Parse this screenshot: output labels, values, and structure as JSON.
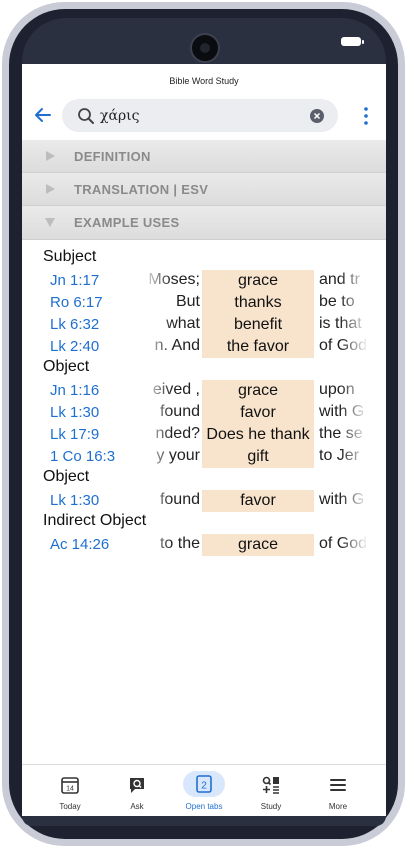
{
  "app": {
    "title": "Bible Word Study"
  },
  "search": {
    "query": "χάρις"
  },
  "sections": [
    {
      "label": "DEFINITION",
      "expanded": false
    },
    {
      "label": "TRANSLATION | ESV",
      "expanded": false
    },
    {
      "label": "EXAMPLE USES",
      "expanded": true
    }
  ],
  "groups": [
    {
      "label": "Subject",
      "rows": [
        {
          "ref": "Jn 1:17",
          "left": "Moses;",
          "word": "grace",
          "right": "and tr"
        },
        {
          "ref": "Ro 6:17",
          "left": "But",
          "word": "thanks",
          "right": "be to"
        },
        {
          "ref": "Lk 6:32",
          "left": "what",
          "word": "benefit",
          "right": "is that"
        },
        {
          "ref": "Lk 2:40",
          "left": "n. And",
          "word": "the favor",
          "right": "of God"
        }
      ]
    },
    {
      "label": "Object",
      "rows": [
        {
          "ref": "Jn 1:16",
          "left": "eived ,",
          "word": "grace",
          "right": "upon"
        },
        {
          "ref": "Lk 1:30",
          "left": "found",
          "word": "favor",
          "right": "with G"
        },
        {
          "ref": "Lk 17:9",
          "left": "nded?",
          "word": "Does he thank",
          "right": "the se"
        },
        {
          "ref": "1 Co 16:3",
          "left": "y your",
          "word": "gift",
          "right": "to Jer"
        }
      ]
    },
    {
      "label": "Object",
      "rows": [
        {
          "ref": "Lk 1:30",
          "left": "found",
          "word": "favor",
          "right": "with G"
        }
      ]
    },
    {
      "label": "Indirect Object",
      "rows": [
        {
          "ref": "Ac 14:26",
          "left": "to the",
          "word": "grace",
          "right": "of God"
        }
      ]
    }
  ],
  "tabs": [
    {
      "label": "Today",
      "icon": "calendar-icon",
      "badge": "14"
    },
    {
      "label": "Ask",
      "icon": "chat-search-icon"
    },
    {
      "label": "Open tabs",
      "icon": "tabs-icon",
      "badge": "2",
      "active": true
    },
    {
      "label": "Study",
      "icon": "study-icon"
    },
    {
      "label": "More",
      "icon": "menu-icon"
    }
  ],
  "colors": {
    "accent": "#1f6fd1",
    "highlight": "#f8e4cd",
    "section_bg": "#e2e2e2"
  }
}
